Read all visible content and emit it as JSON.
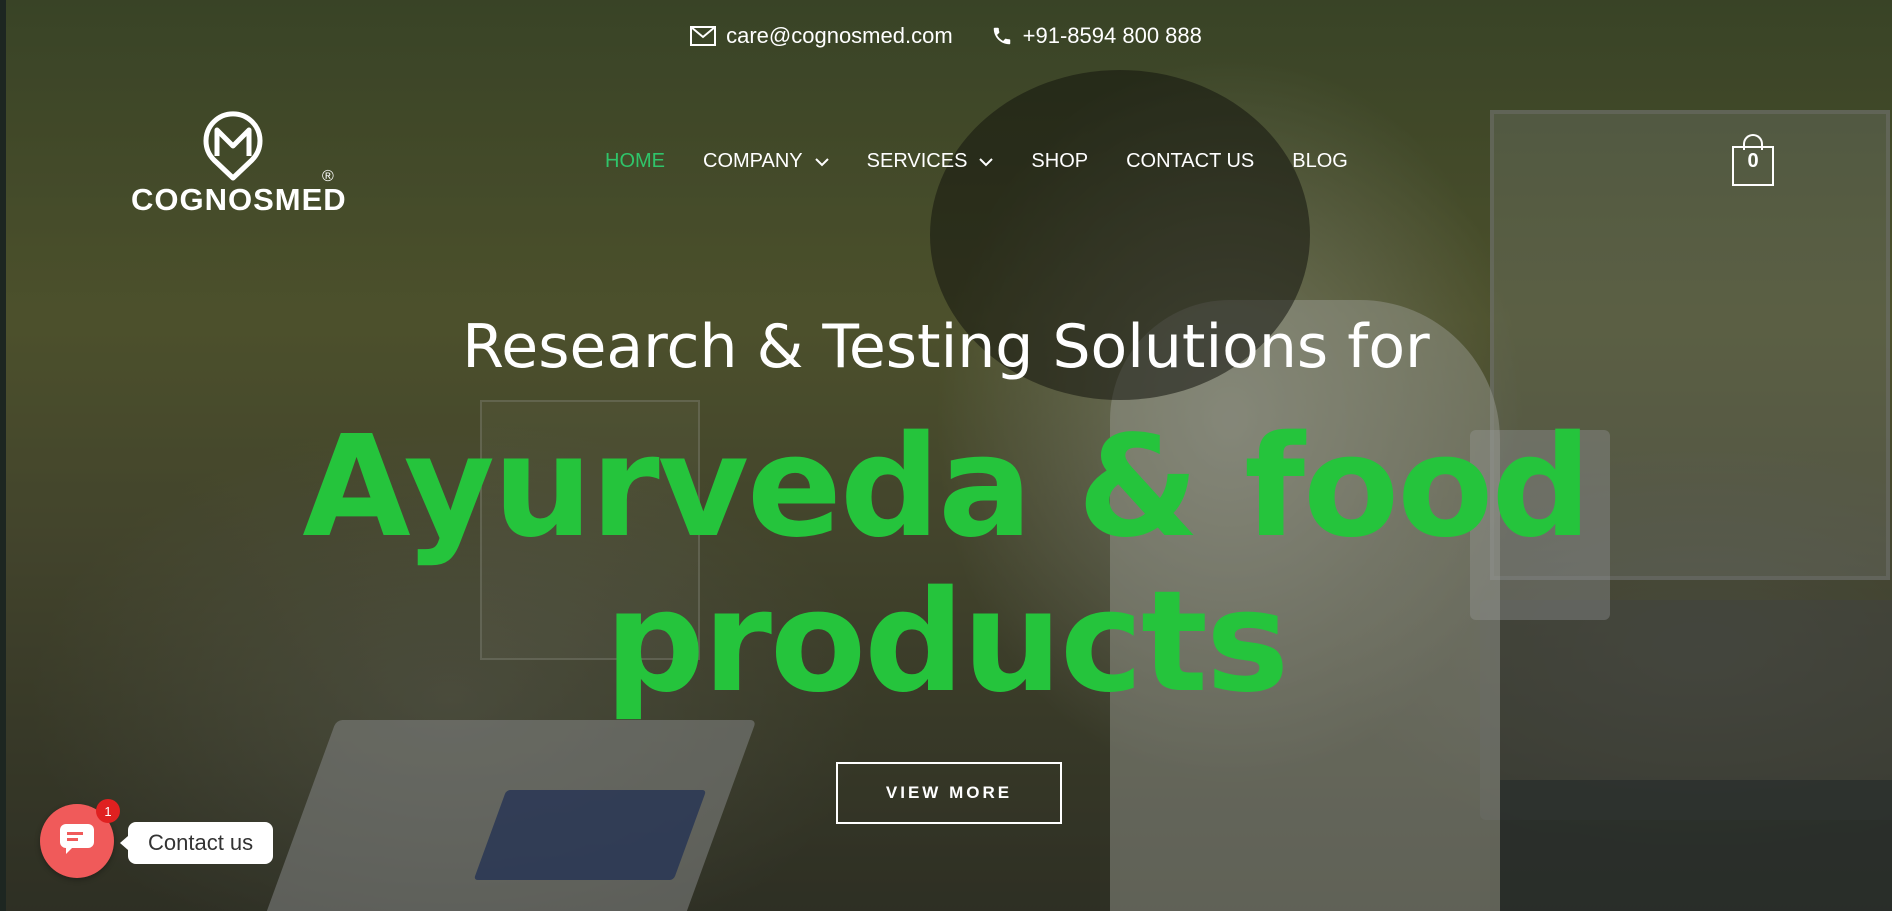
{
  "topbar": {
    "email": "care@cognosmed.com",
    "phone": "+91-8594 800 888"
  },
  "brand": {
    "name": "COGNOSMED",
    "registered": "®"
  },
  "nav": {
    "items": [
      {
        "label": "HOME",
        "active": true,
        "dropdown": false
      },
      {
        "label": "COMPANY",
        "active": false,
        "dropdown": true
      },
      {
        "label": "SERVICES",
        "active": false,
        "dropdown": true
      },
      {
        "label": "SHOP",
        "active": false,
        "dropdown": false
      },
      {
        "label": "CONTACT US",
        "active": false,
        "dropdown": false
      },
      {
        "label": "BLOG",
        "active": false,
        "dropdown": false
      }
    ],
    "active_color": "#2fc46a"
  },
  "cart": {
    "count": "0"
  },
  "hero": {
    "subtitle": "Research & Testing Solutions for",
    "title_line1": "Ayurveda & food",
    "title_line2": "products",
    "title_color": "#25c43c",
    "cta_label": "VIEW MORE"
  },
  "chat": {
    "label": "Contact us",
    "badge": "1",
    "button_color": "#f05a5a"
  }
}
